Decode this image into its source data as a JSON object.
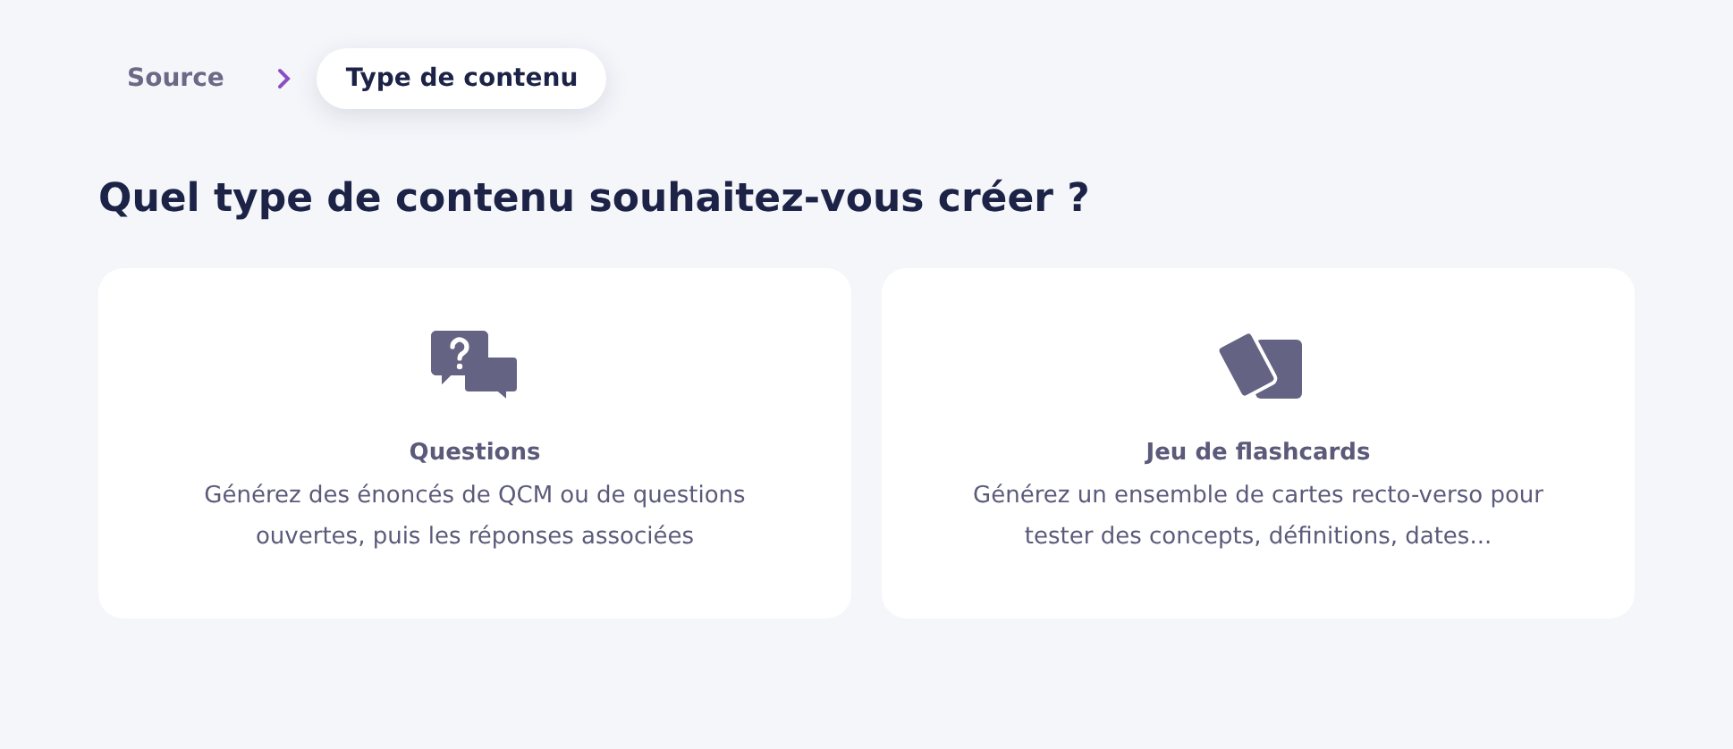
{
  "breadcrumb": [
    {
      "label": "Source",
      "selected": false
    },
    {
      "label": "Type de contenu",
      "selected": true
    }
  ],
  "heading": "Quel type de contenu souhaitez-vous créer ?",
  "options": [
    {
      "kind": "questions",
      "title": "Questions",
      "description": "Générez des énoncés de QCM ou de questions ouvertes, puis les réponses associées"
    },
    {
      "kind": "flashcards",
      "title": "Jeu de flashcards",
      "description": "Générez un ensemble de cartes recto-verso pour tester des concepts, définitions, dates..."
    }
  ]
}
